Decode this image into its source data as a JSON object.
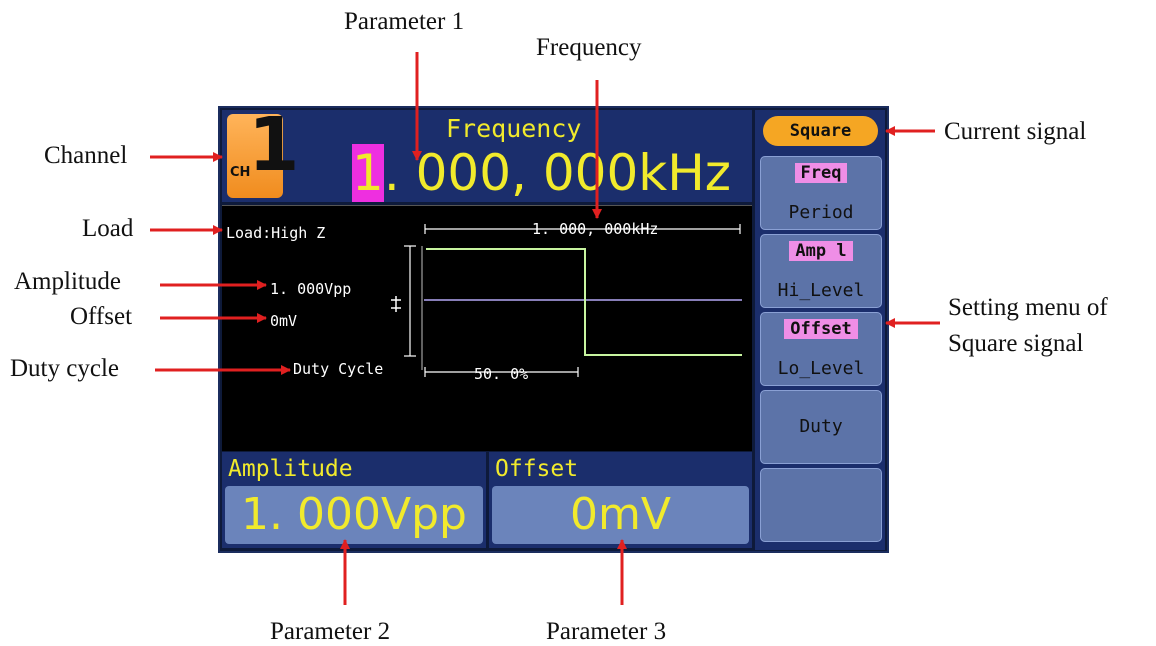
{
  "annotations": {
    "parameter_1": "Parameter 1",
    "frequency": "Frequency",
    "channel": "Channel",
    "load": "Load",
    "amplitude": "Amplitude",
    "offset": "Offset",
    "duty_cycle": "Duty cycle",
    "current_signal": "Current signal",
    "setting_menu_line1": "Setting menu of",
    "setting_menu_line2": "Square signal",
    "parameter_2": "Parameter 2",
    "parameter_3": "Parameter 3"
  },
  "screen": {
    "channel_text": "CH",
    "channel_number": "1",
    "freq_title": "Frequency",
    "freq_highlight": "1",
    "freq_rest": ". 000, 000kHz",
    "load": "Load:High Z",
    "freq_marker": "1. 000, 000kHz",
    "amplitude": "1. 000Vpp",
    "offset": "0mV",
    "duty_label": "Duty Cycle",
    "duty_value": "50. 0%",
    "param2_title": "Amplitude",
    "param2_value": "1. 000Vpp",
    "param3_title": "Offset",
    "param3_value": "0mV"
  },
  "menu": {
    "current_signal": "Square",
    "items": [
      {
        "top": "Freq",
        "bottom": "Period"
      },
      {
        "top": "Amp l",
        "bottom": "Hi_Level"
      },
      {
        "top": "Offset",
        "bottom": "Lo_Level"
      },
      {
        "top": "",
        "bottom": "Duty"
      },
      {
        "top": "",
        "bottom": ""
      }
    ]
  },
  "colors": {
    "screen_bg": "#0e1a3a",
    "panel_blue": "#1b2e6c",
    "value_yellow": "#f1ea2c",
    "highlight_magenta": "#ee2fe0",
    "menu_button": "#5c73a8",
    "menu_highlight": "#ef8ee6",
    "signal_tab": "#f5a623",
    "waveform_green": "#c8f5a0",
    "annotation_red": "#e02020"
  }
}
